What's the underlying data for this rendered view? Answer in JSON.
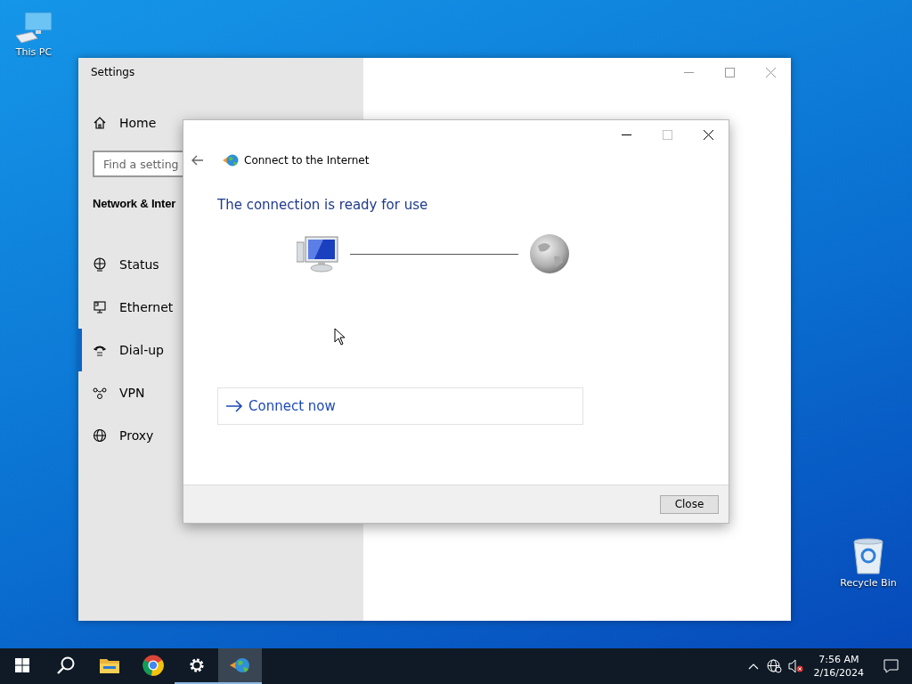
{
  "desktop_icons": [
    {
      "kind": "pc",
      "label": "This PC"
    },
    {
      "kind": "bin",
      "label": "Recycle Bin"
    }
  ],
  "settings_window": {
    "title": "Settings",
    "home": "Home",
    "search": {
      "placeholder": "Find a setting"
    },
    "section": "Network & Inter",
    "items": [
      {
        "kind": "status",
        "label": "Status",
        "selected": false
      },
      {
        "kind": "ethernet",
        "label": "Ethernet",
        "selected": false
      },
      {
        "kind": "dialup",
        "label": "Dial-up",
        "selected": true
      },
      {
        "kind": "vpn",
        "label": "VPN",
        "selected": false
      },
      {
        "kind": "proxy",
        "label": "Proxy",
        "selected": false
      }
    ]
  },
  "dialog": {
    "title": "Connect to the Internet",
    "maximize_disabled": true,
    "heading": "The connection is ready for use",
    "action": "Connect now",
    "buttons": [
      "Close"
    ]
  },
  "taskbar": {
    "items": [
      {
        "kind": "start",
        "running": false,
        "selected": false
      },
      {
        "kind": "search",
        "running": false,
        "selected": false
      },
      {
        "kind": "folder",
        "running": false,
        "selected": false
      },
      {
        "kind": "chrome",
        "running": false,
        "selected": false
      },
      {
        "kind": "gear",
        "running": true,
        "selected": false
      },
      {
        "kind": "connect",
        "running": true,
        "selected": true
      }
    ],
    "clock": {
      "time": "7:56 AM",
      "date": "2/16/2024"
    }
  }
}
